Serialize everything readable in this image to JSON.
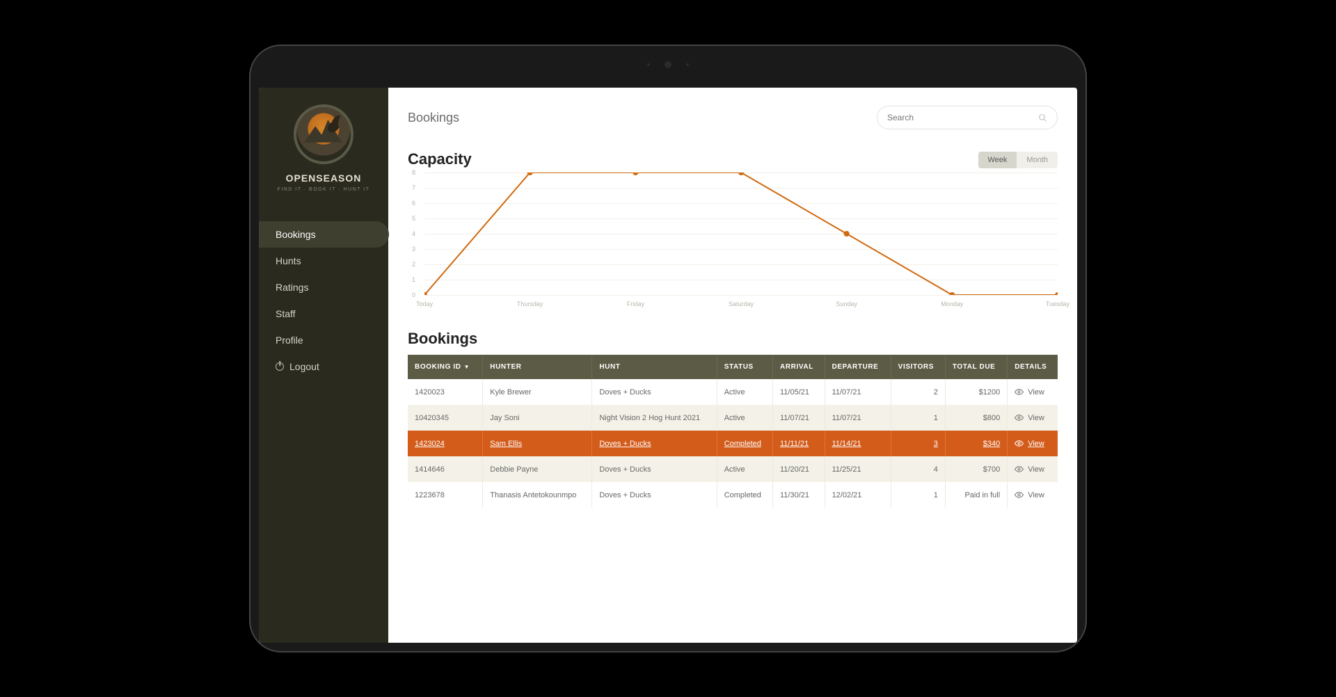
{
  "brand": {
    "name": "OPENSEASON",
    "tagline": "FIND IT · BOOK IT · HUNT IT"
  },
  "sidebar": {
    "items": [
      {
        "label": "Bookings",
        "active": true
      },
      {
        "label": "Hunts",
        "active": false
      },
      {
        "label": "Ratings",
        "active": false
      },
      {
        "label": "Staff",
        "active": false
      },
      {
        "label": "Profile",
        "active": false
      },
      {
        "label": "Logout",
        "active": false,
        "icon": "power"
      }
    ]
  },
  "header": {
    "title": "Bookings",
    "search_placeholder": "Search"
  },
  "capacity": {
    "title": "Capacity",
    "toggle": {
      "options": [
        "Week",
        "Month"
      ],
      "selected": "Week"
    }
  },
  "chart_data": {
    "type": "line",
    "title": "Capacity",
    "xlabel": "",
    "ylabel": "",
    "ylim": [
      0,
      8
    ],
    "y_ticks": [
      0,
      1,
      2,
      3,
      4,
      5,
      6,
      7,
      8
    ],
    "categories": [
      "Today",
      "Thursday",
      "Friday",
      "Saturday",
      "Sunday",
      "Monday",
      "Tuesday"
    ],
    "values": [
      0,
      8,
      8,
      8,
      4,
      0,
      0
    ],
    "color": "#d1690f"
  },
  "bookings_section": {
    "title": "Bookings"
  },
  "table": {
    "columns": [
      {
        "label": "BOOKING ID",
        "sort": "desc"
      },
      {
        "label": "HUNTER"
      },
      {
        "label": "HUNT"
      },
      {
        "label": "STATUS"
      },
      {
        "label": "ARRIVAL"
      },
      {
        "label": "DEPARTURE"
      },
      {
        "label": "VISITORS",
        "align": "right"
      },
      {
        "label": "TOTAL DUE",
        "align": "right"
      },
      {
        "label": "DETAILS"
      }
    ],
    "view_label": "View",
    "rows": [
      {
        "id": "1420023",
        "hunter": "Kyle Brewer",
        "hunt": "Doves + Ducks",
        "status": "Active",
        "arrival": "11/05/21",
        "departure": "11/07/21",
        "visitors": "2",
        "total": "$1200",
        "highlighted": false
      },
      {
        "id": "10420345",
        "hunter": "Jay Soni",
        "hunt": "Night Vision 2 Hog Hunt 2021",
        "status": "Active",
        "arrival": "11/07/21",
        "departure": "11/07/21",
        "visitors": "1",
        "total": "$800",
        "highlighted": false
      },
      {
        "id": "1423024",
        "hunter": "Sam Ellis",
        "hunt": "Doves + Ducks",
        "status": "Completed",
        "arrival": "11/11/21",
        "departure": "11/14/21",
        "visitors": "3",
        "total": "$340",
        "highlighted": true
      },
      {
        "id": "1414646",
        "hunter": "Debbie Payne",
        "hunt": "Doves + Ducks",
        "status": "Active",
        "arrival": "11/20/21",
        "departure": "11/25/21",
        "visitors": "4",
        "total": "$700",
        "highlighted": false
      },
      {
        "id": "1223678",
        "hunter": "Thanasis Antetokounmpo",
        "hunt": "Doves + Ducks",
        "status": "Completed",
        "arrival": "11/30/21",
        "departure": "12/02/21",
        "visitors": "1",
        "total": "Paid in full",
        "highlighted": false
      }
    ]
  }
}
